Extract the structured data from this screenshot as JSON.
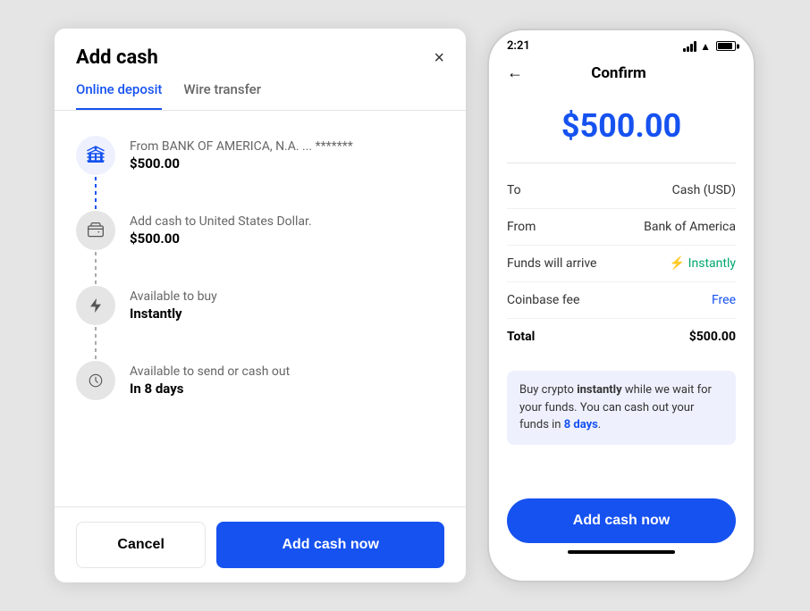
{
  "left": {
    "title": "Add cash",
    "close_label": "×",
    "tabs": [
      {
        "id": "online-deposit",
        "label": "Online deposit",
        "active": true
      },
      {
        "id": "wire-transfer",
        "label": "Wire transfer",
        "active": false
      }
    ],
    "steps": [
      {
        "id": "bank",
        "icon_type": "bank",
        "label": "From BANK OF AMERICA, N.A. ... *******",
        "value": "$500.00"
      },
      {
        "id": "wallet",
        "icon_type": "wallet",
        "label": "Add cash to United States Dollar.",
        "value": "$500.00"
      },
      {
        "id": "bolt",
        "icon_type": "bolt",
        "label": "Available to buy",
        "value": "Instantly"
      },
      {
        "id": "clock",
        "icon_type": "clock",
        "label": "Available to send or cash out",
        "value": "In 8 days"
      }
    ],
    "footer": {
      "cancel_label": "Cancel",
      "add_cash_label": "Add cash now"
    }
  },
  "right": {
    "status_bar": {
      "time": "2:21"
    },
    "nav": {
      "back_icon": "←",
      "title": "Confirm"
    },
    "amount": "$500.00",
    "rows": [
      {
        "label": "To",
        "value": "Cash (USD)",
        "bold": false,
        "color": "normal"
      },
      {
        "label": "From",
        "value": "Bank of America",
        "bold": false,
        "color": "normal"
      },
      {
        "label": "Funds will arrive",
        "value": "⚡ Instantly",
        "bold": false,
        "color": "green"
      },
      {
        "label": "Coinbase fee",
        "value": "Free",
        "bold": false,
        "color": "blue"
      },
      {
        "label": "Total",
        "value": "$500.00",
        "bold": true,
        "color": "bold"
      }
    ],
    "info_box": {
      "text_parts": [
        {
          "text": "Buy crypto ",
          "bold": false
        },
        {
          "text": "instantly",
          "bold": true
        },
        {
          "text": " while we wait for your funds. You can cash out your funds in ",
          "bold": false
        },
        {
          "text": "8 days",
          "bold": true,
          "blue": true
        },
        {
          "text": ".",
          "bold": false
        }
      ]
    },
    "add_cash_label": "Add cash now"
  }
}
